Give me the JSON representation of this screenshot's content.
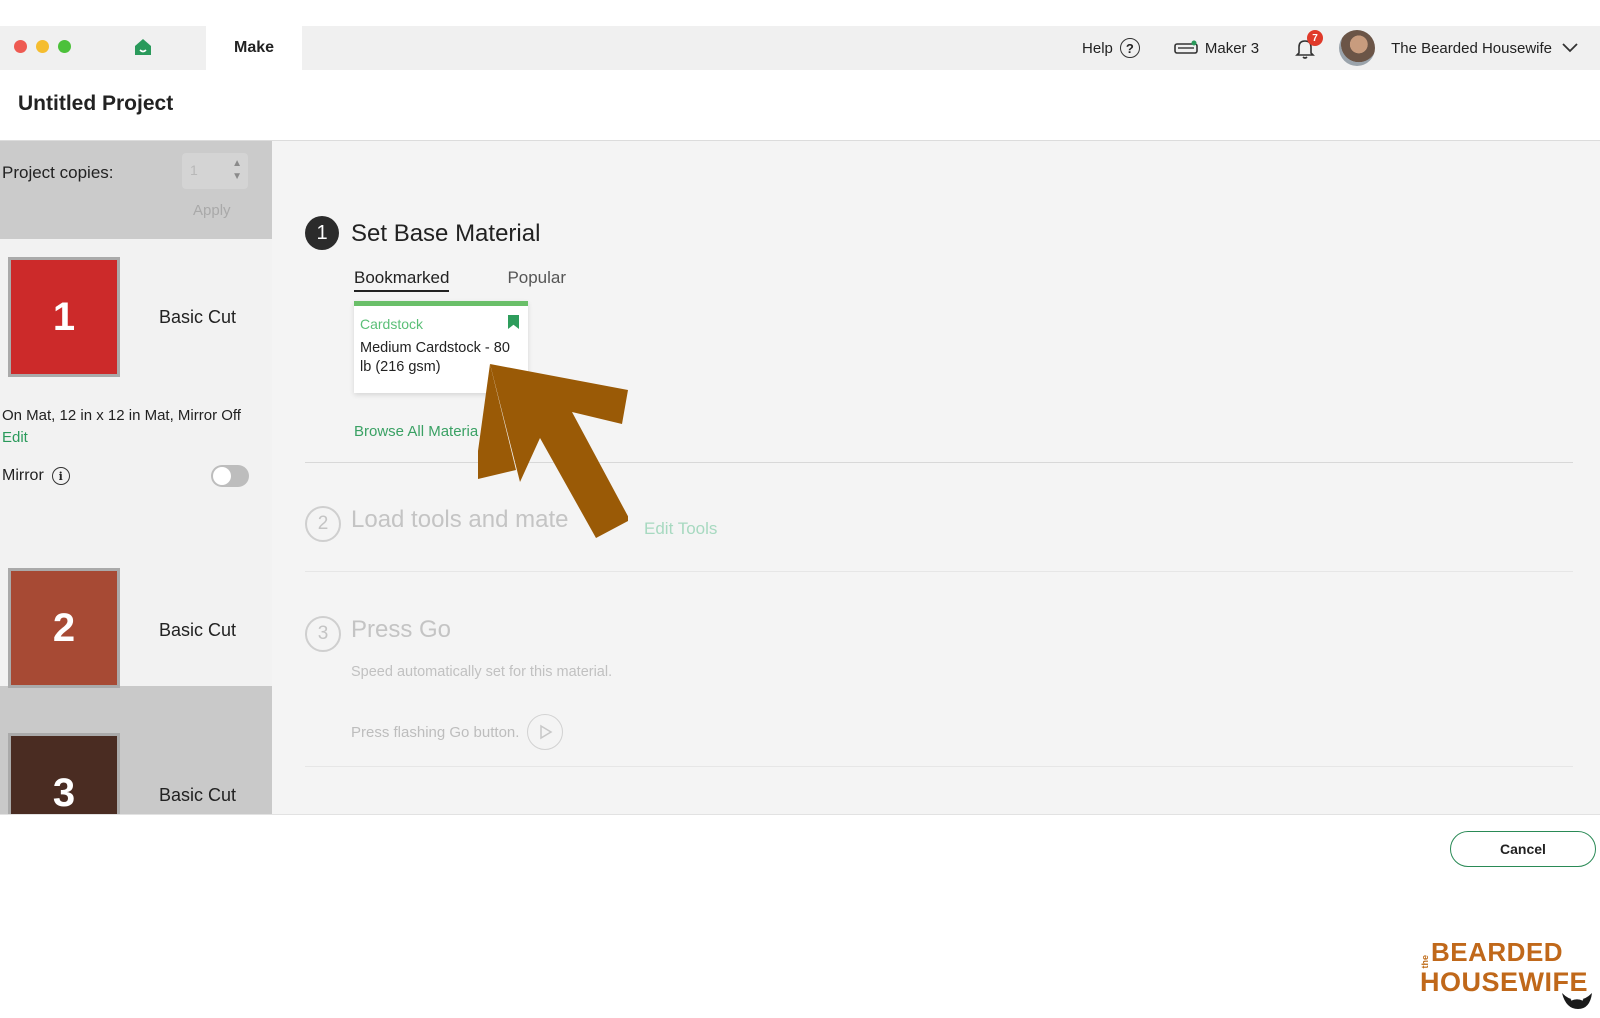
{
  "titlebar": {
    "tab_make": "Make",
    "help_label": "Help",
    "machine_label": "Maker 3",
    "notification_count": "7",
    "user_name": "The Bearded Housewife"
  },
  "header": {
    "project_title": "Untitled Project"
  },
  "sidebar": {
    "copies_label": "Project copies:",
    "copies_value": "1",
    "apply_label": "Apply",
    "mats": [
      {
        "number": "1",
        "label": "Basic Cut",
        "color": "#cc2a2a"
      },
      {
        "number": "2",
        "label": "Basic Cut",
        "color": "#a74a34"
      },
      {
        "number": "3",
        "label": "Basic Cut",
        "color": "#4a2c22"
      }
    ],
    "mat_info": "On Mat, 12 in x 12 in Mat, Mirror Off",
    "edit_label": "Edit",
    "mirror_label": "Mirror"
  },
  "steps": {
    "step1": {
      "number": "1",
      "title": "Set Base Material"
    },
    "tabs": {
      "bookmarked": "Bookmarked",
      "popular": "Popular"
    },
    "card": {
      "category": "Cardstock",
      "name": "Medium Cardstock - 80 lb (216 gsm)"
    },
    "browse_label": "Browse All Materia",
    "step2": {
      "number": "2",
      "title": "Load tools and mate",
      "edit_tools": "Edit Tools"
    },
    "step3": {
      "number": "3",
      "title": "Press Go",
      "speed_text": "Speed automatically set for this material.",
      "press_text": "Press flashing Go button."
    }
  },
  "footer": {
    "cancel_label": "Cancel"
  },
  "brand": {
    "small": "the",
    "line1": "BEARDED",
    "line2": "HOUSEWIFE"
  },
  "colors": {
    "accent_green": "#2a9a5b",
    "arrow": "#9a5a06",
    "brand": "#c0681a"
  }
}
